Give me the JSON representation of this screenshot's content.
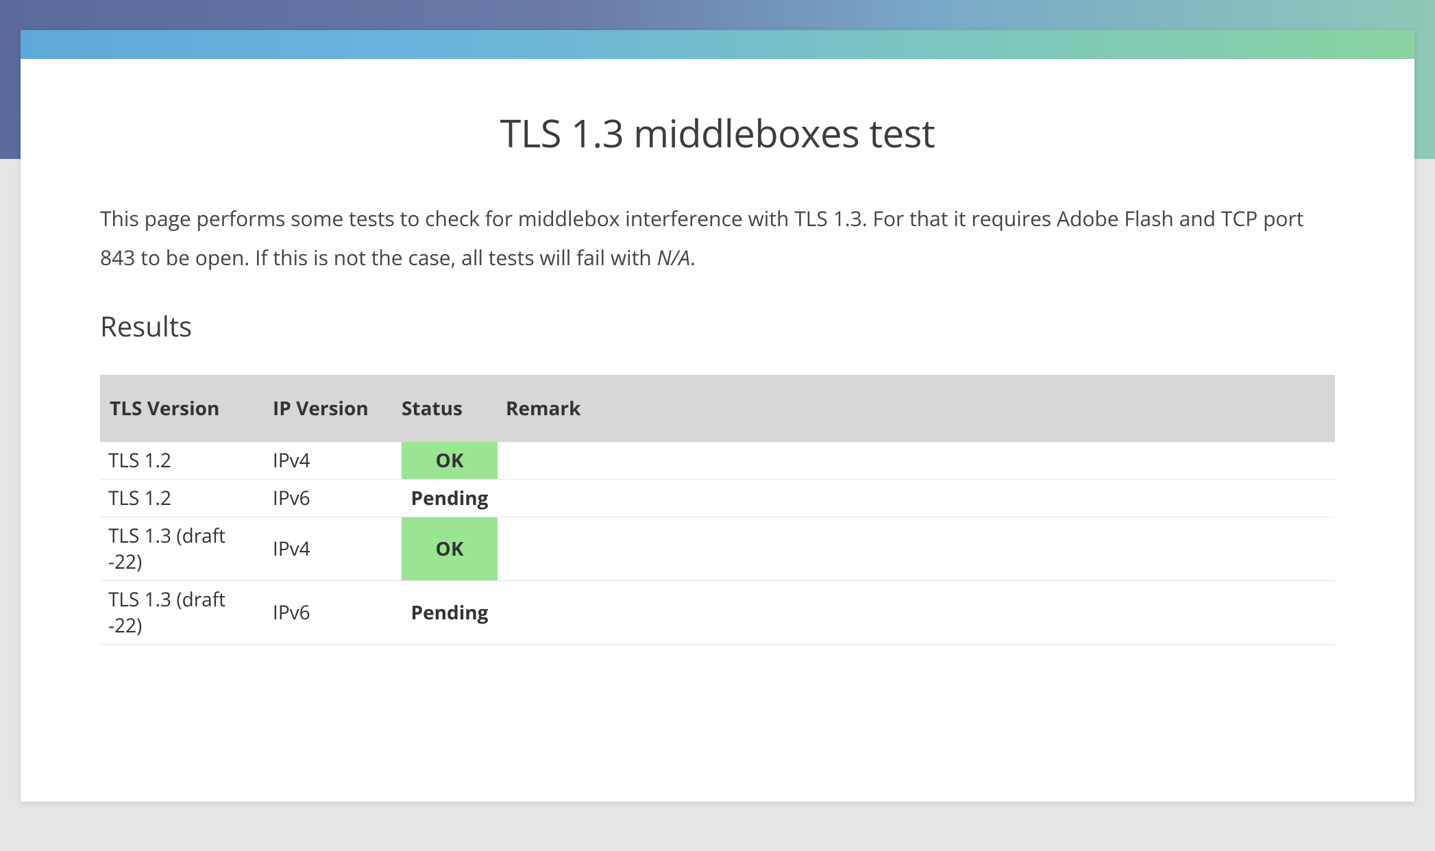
{
  "header": {
    "title": "TLS 1.3 middleboxes test"
  },
  "intro": {
    "text": "This page performs some tests to check for middlebox interference with TLS 1.3. For that it requires Adobe Flash and TCP port 843 to be open. If this is not the case, all tests will fail with ",
    "na": "N/A",
    "suffix": "."
  },
  "section": {
    "results_title": "Results"
  },
  "table": {
    "columns": {
      "tls_version": "TLS Version",
      "ip_version": "IP Version",
      "status": "Status",
      "remark": "Remark"
    },
    "rows": [
      {
        "tls": "TLS 1.2",
        "ip": "IPv4",
        "status": "OK",
        "status_class": "status-ok",
        "remark": ""
      },
      {
        "tls": "TLS 1.2",
        "ip": "IPv6",
        "status": "Pending",
        "status_class": "status-pending",
        "remark": ""
      },
      {
        "tls": "TLS 1.3 (draft -22)",
        "ip": "IPv4",
        "status": "OK",
        "status_class": "status-ok",
        "remark": ""
      },
      {
        "tls": "TLS 1.3 (draft -22)",
        "ip": "IPv6",
        "status": "Pending",
        "status_class": "status-pending",
        "remark": ""
      }
    ]
  }
}
